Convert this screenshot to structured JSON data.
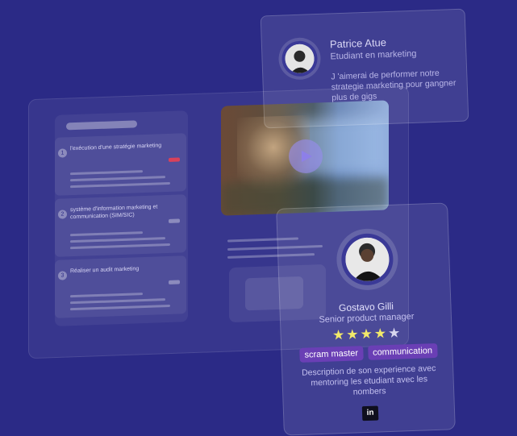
{
  "course": {
    "modules": [
      {
        "number": "1",
        "title": "l'exécution d'une stratégie marketing"
      },
      {
        "number": "2",
        "title": "système d'information marketing et communication (SIM/SIC)"
      },
      {
        "number": "3",
        "title": "Réaliser un audit marketing"
      }
    ]
  },
  "testimonial": {
    "name": "Patrice Atue",
    "role": "Etudiant en marketing",
    "quote": "J 'aimerai de performer notre strategie marketing pour gangner plus de gigs"
  },
  "mentor": {
    "name": "Gostavo Gilli",
    "role": "Senior product manager",
    "rating": 4,
    "rating_max": 5,
    "tags": [
      "scram master",
      "communication"
    ],
    "description": "Description de son experience avec mentoring les etudiant avec les nombers",
    "linkedin_label": "in"
  },
  "colors": {
    "background": "#2b2a86",
    "tag": "#6a3fb5",
    "star": "#f2e96a"
  },
  "icons": [
    "play-icon",
    "linkedin-icon",
    "star-icon"
  ]
}
